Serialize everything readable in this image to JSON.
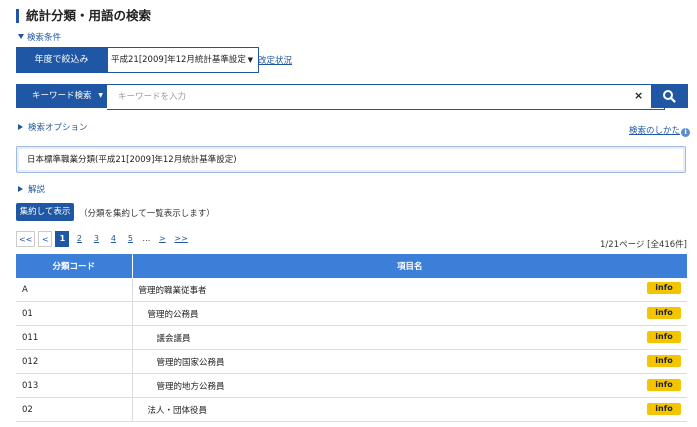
{
  "title": "統計分類・用語の検索",
  "search_conditions": {
    "toggle_label": "検索条件",
    "year_label": "年度で絞込み",
    "year_value": "平成21[2009]年12月統計基準設定",
    "revision_link": "改定状況",
    "keyword_label": "キーワード検索",
    "keyword_value": "",
    "keyword_placeholder": "キーワードを入力",
    "clear_symbol": "×"
  },
  "options_label": "検索オプション",
  "howto_link": "検索のしかた",
  "selected_classification": "日本標準職業分類(平成21[2009]年12月統計基準設定)",
  "explanation_label": "解説",
  "aggregate_button": "集約して表示",
  "aggregate_note": "（分類を集約して一覧表示します）",
  "pagination": {
    "first": "<<",
    "prev": "<",
    "pages": [
      "1",
      "2",
      "3",
      "4",
      "5"
    ],
    "current": "1",
    "ellipsis": "…",
    "next": ">",
    "last": ">>"
  },
  "result_count": "1/21ページ [全416件]",
  "table": {
    "headers": [
      "分類コード",
      "項目名"
    ],
    "info_label": "info",
    "rows": [
      {
        "code": "A",
        "name": "管理的職業従事者",
        "level": 0
      },
      {
        "code": "01",
        "name": "管理的公務員",
        "level": 1
      },
      {
        "code": "011",
        "name": "議会議員",
        "level": 2
      },
      {
        "code": "012",
        "name": "管理的国家公務員",
        "level": 2
      },
      {
        "code": "013",
        "name": "管理的地方公務員",
        "level": 2
      },
      {
        "code": "02",
        "name": "法人・団体役員",
        "level": 1
      }
    ]
  },
  "colors": {
    "primary": "#1f57a4",
    "table_header": "#3c7fd8",
    "info_badge": "#f2c500"
  }
}
